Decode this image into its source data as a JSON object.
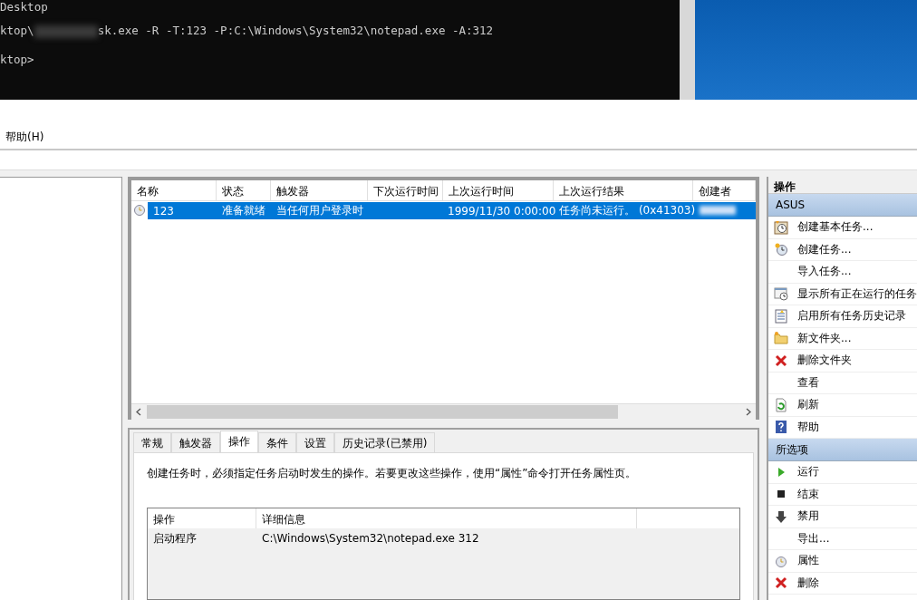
{
  "terminal": {
    "lines": [
      {
        "text": "Desktop"
      },
      {
        "text": "ktop\\",
        "redacted": true,
        "rest": "sk.exe -R -T:123 -P:C:\\Windows\\System32\\notepad.exe -A:312"
      },
      {
        "text": "ktop>"
      }
    ]
  },
  "menu": [
    "帮助(H)"
  ],
  "task_list": {
    "columns": [
      "名称",
      "状态",
      "触发器",
      "下次运行时间",
      "上次运行时间",
      "上次运行结果",
      "创建者"
    ],
    "rows": [
      {
        "name": "123",
        "status": "准备就绪",
        "trigger": "当任何用户登录时",
        "last_run": "1999/11/30 0:00:00",
        "last_result": "任务尚未运行。 (0x41303)",
        "creator_redacted": true,
        "selected": true
      }
    ]
  },
  "tabs": [
    {
      "label": "常规",
      "selected": false
    },
    {
      "label": "触发器",
      "selected": false
    },
    {
      "label": "操作",
      "selected": true
    },
    {
      "label": "条件",
      "selected": false
    },
    {
      "label": "设置",
      "selected": false
    },
    {
      "label": "历史记录(已禁用)",
      "selected": false
    }
  ],
  "description": "创建任务时，必须指定任务启动时发生的操作。若要更改这些操作，使用“属性”命令打开任务属性页。",
  "actions_table": {
    "columns": [
      "操作",
      "详细信息"
    ],
    "rows": [
      {
        "action": "启动程序",
        "detail": "C:\\Windows\\System32\\notepad.exe 312"
      }
    ]
  },
  "actions_panel": {
    "title": "操作",
    "sections": [
      {
        "header": "ASUS",
        "items": [
          {
            "label": "创建基本任务...",
            "kind": "clock-card"
          },
          {
            "label": "创建任务...",
            "kind": "clock-star"
          },
          {
            "label": "导入任务...",
            "kind": "none"
          },
          {
            "label": "显示所有正在运行的任务",
            "kind": "calendar"
          },
          {
            "label": "启用所有任务历史记录",
            "kind": "log"
          },
          {
            "label": "新文件夹...",
            "kind": "folder"
          },
          {
            "label": "删除文件夹",
            "kind": "cross"
          },
          {
            "label": "查看",
            "kind": "none"
          },
          {
            "label": "刷新",
            "kind": "refresh"
          },
          {
            "label": "帮助",
            "kind": "help"
          }
        ]
      },
      {
        "header": "所选项",
        "items": [
          {
            "label": "运行",
            "kind": "play"
          },
          {
            "label": "结束",
            "kind": "stop"
          },
          {
            "label": "禁用",
            "kind": "down-arrow"
          },
          {
            "label": "导出...",
            "kind": "none"
          },
          {
            "label": "属性",
            "kind": "clock"
          },
          {
            "label": "删除",
            "kind": "cross"
          }
        ]
      }
    ]
  }
}
